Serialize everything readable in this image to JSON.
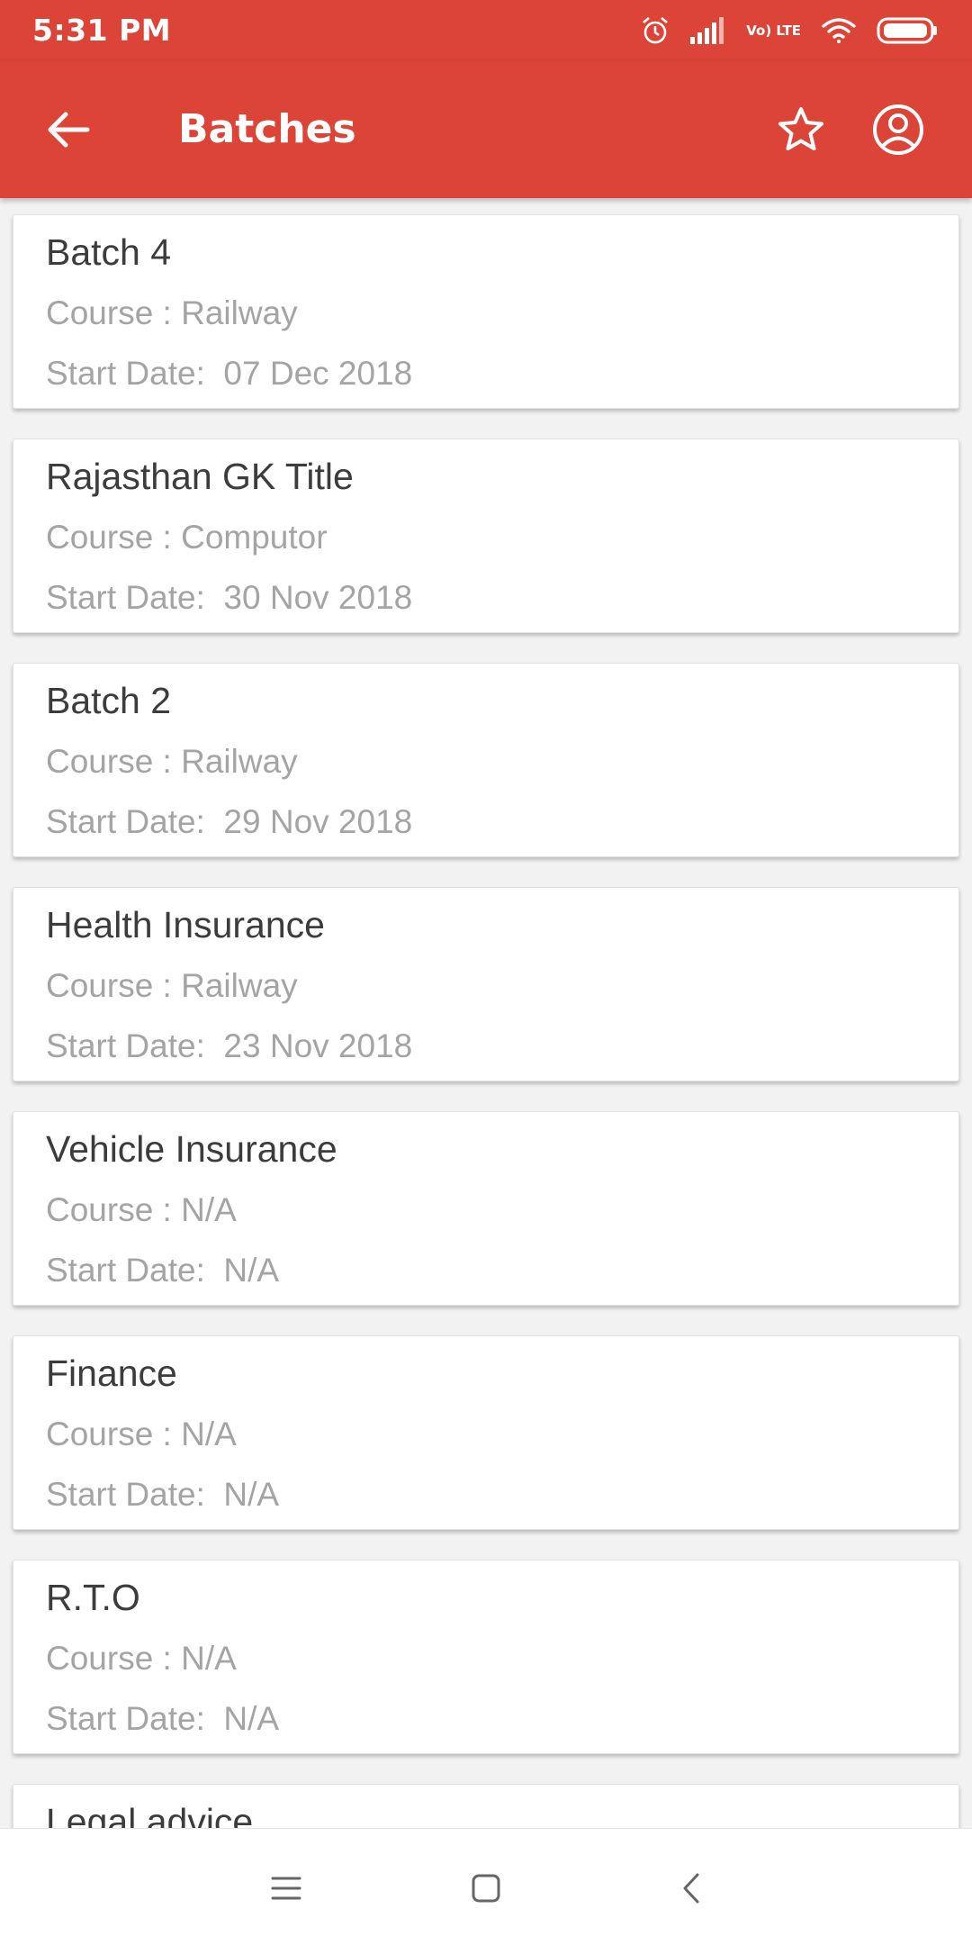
{
  "status_bar": {
    "time": "5:31 PM",
    "network_label": "Vo) LTE",
    "icons": [
      "alarm-icon",
      "signal-icon",
      "volte-icon",
      "wifi-icon",
      "battery-icon"
    ]
  },
  "app_bar": {
    "title": "Batches",
    "color": "#db4437",
    "icons": [
      "back-arrow-icon",
      "star-icon",
      "account-circle-icon"
    ]
  },
  "batches": [
    {
      "title": "Batch 4",
      "course": "Course : Railway",
      "start_date": "Start Date:  07 Dec 2018"
    },
    {
      "title": "Rajasthan GK Title",
      "course": "Course : Computor",
      "start_date": "Start Date:  30 Nov 2018"
    },
    {
      "title": "Batch 2",
      "course": "Course : Railway",
      "start_date": "Start Date:  29 Nov 2018"
    },
    {
      "title": "Health Insurance",
      "course": "Course : Railway",
      "start_date": "Start Date:  23 Nov 2018"
    },
    {
      "title": "Vehicle Insurance",
      "course": "Course : N/A",
      "start_date": "Start Date:  N/A"
    },
    {
      "title": "Finance",
      "course": "Course : N/A",
      "start_date": "Start Date:  N/A"
    },
    {
      "title": "R.T.O",
      "course": "Course : N/A",
      "start_date": "Start Date:  N/A"
    },
    {
      "title": "Legal advice"
    }
  ],
  "nav_bar": {
    "icons": [
      "menu-icon",
      "home-icon",
      "back-icon"
    ]
  }
}
